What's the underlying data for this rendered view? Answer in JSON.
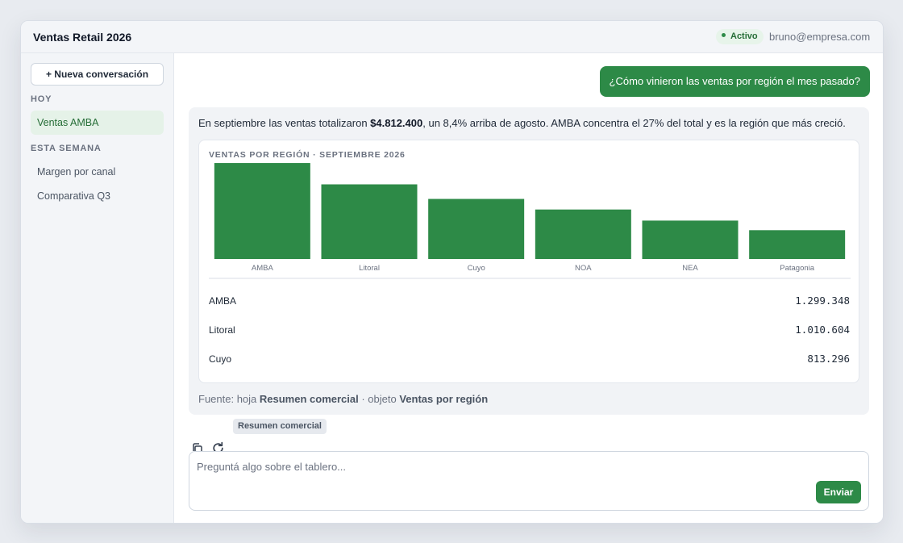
{
  "header": {
    "title": "Ventas Retail 2026",
    "status": "Activo",
    "user_email": "bruno@empresa.com"
  },
  "sidebar": {
    "new_conversation": "+ Nueva conversación",
    "sections": [
      {
        "label": "HOY",
        "items": [
          {
            "label": "Ventas AMBA",
            "active": true
          }
        ]
      },
      {
        "label": "ESTA SEMANA",
        "items": [
          {
            "label": "Margen por canal"
          },
          {
            "label": "Comparativa Q3"
          }
        ]
      }
    ]
  },
  "chat": {
    "user_message": "¿Cómo vinieron las ventas por región el mes pasado?",
    "answer": {
      "intro_before": "En septiembre las ventas totalizaron ",
      "intro_total": "$4.812.400",
      "intro_after": ", un 8,4% arriba de agosto. AMBA concentra el 27% del total y es la región que más creció.",
      "chart_title": "VENTAS POR REGIÓN · SEPTIEMBRE 2026",
      "rows": [
        {
          "name": "AMBA",
          "value": "1.299.348"
        },
        {
          "name": "Litoral",
          "value": "1.010.604"
        },
        {
          "name": "Cuyo",
          "value": "813.296"
        }
      ],
      "source_prefix": "Fuente: hoja ",
      "source_sheet": "Resumen comercial",
      "source_mid": " · objeto ",
      "source_object": "Ventas por región"
    },
    "source_chip": "Resumen comercial",
    "icons": {
      "copy": "copy-icon",
      "regenerate": "refresh-icon"
    }
  },
  "composer": {
    "placeholder": "Preguntá algo sobre el tablero...",
    "value": "",
    "send_label": "Enviar"
  },
  "colors": {
    "accent": "#2d8a47",
    "bar": "#2d8a47"
  },
  "chart_data": {
    "type": "bar",
    "title": "VENTAS POR REGIÓN · SEPTIEMBRE 2026",
    "categories": [
      "AMBA",
      "Litoral",
      "Cuyo",
      "NOA",
      "NEA",
      "Patagonia"
    ],
    "values": [
      1299348,
      1010604,
      813296,
      670000,
      520000,
      390000
    ],
    "xlabel": "",
    "ylabel": "",
    "ylim": [
      0,
      1300000
    ],
    "grid": false,
    "legend": "none"
  }
}
